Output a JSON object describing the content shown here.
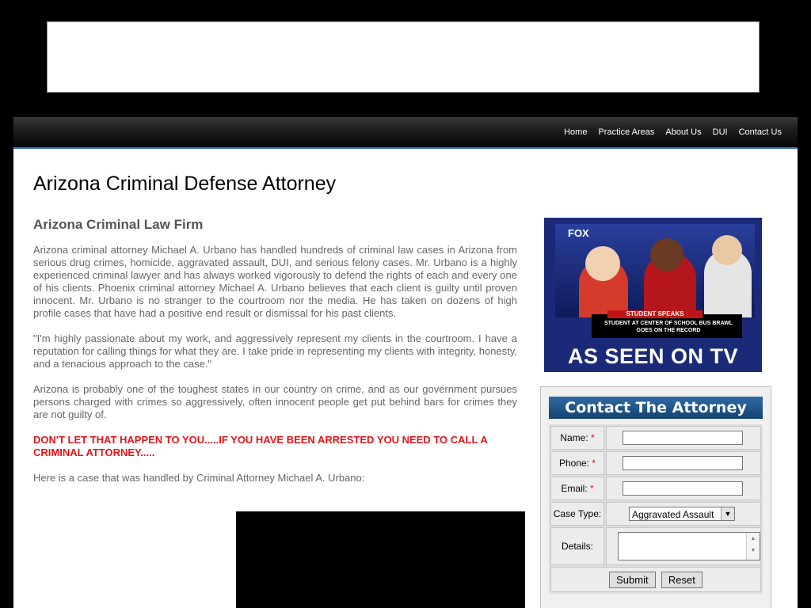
{
  "nav": {
    "items": [
      "Home",
      "Practice Areas",
      "About Us",
      "DUI",
      "Contact Us"
    ]
  },
  "page": {
    "title": "Arizona Criminal Defense Attorney",
    "section_heading": "Arizona Criminal Law Firm",
    "paragraphs": [
      "Arizona criminal attorney Michael A. Urbano has handled hundreds of criminal law cases in Arizona from serious drug crimes, homicide, aggravated assault, DUI, and serious felony cases. Mr. Urbano is a highly experienced criminal lawyer and has always worked vigorously to defend the rights of each and every one of his clients. Phoenix criminal attorney Michael A. Urbano believes that each client is guilty until proven innocent. Mr. Urbano is no stranger to the courtroom nor the media. He has taken on dozens of high profile cases that have had a positive end result or dismissal for his past clients.",
      "\"I'm highly passionate about my work, and aggressively represent my clients in the courtroom. I have a reputation for calling things for what they are. I take pride in representing my clients with integrity, honesty, and a tenacious approach to the case.\"",
      "Arizona is probably one of the toughest states in our country on crime, and as our government pursues persons charged with crimes so aggressively, often innocent people get put behind bars for crimes they are not guilty of."
    ],
    "alert": "DON'T LET THAT HAPPEN TO YOU.....IF YOU HAVE BEEN ARRESTED YOU NEED TO CALL A CRIMINAL ATTORNEY.....",
    "case_intro": "Here is a case that was handled by Criminal Attorney Michael A. Urbano:"
  },
  "promo": {
    "logo": "FOX",
    "banner_label": "STUDENT SPEAKS",
    "banner_text": "STUDENT AT CENTER OF SCHOOL BUS BRAWL GOES ON THE RECORD",
    "caption": "AS SEEN ON TV"
  },
  "contact": {
    "header": "Contact The Attorney",
    "name_label": "Name:",
    "phone_label": "Phone:",
    "email_label": "Email:",
    "required_mark": "*",
    "case_type_label": "Case Type:",
    "case_type_value": "Aggravated Assault",
    "details_label": "Details:",
    "submit_label": "Submit",
    "reset_label": "Reset"
  },
  "colors": {
    "nav_accent": "#3f6fd1",
    "alert_red": "#e3141b",
    "required_red": "#d11111",
    "contact_header_blue": "#14436f"
  }
}
